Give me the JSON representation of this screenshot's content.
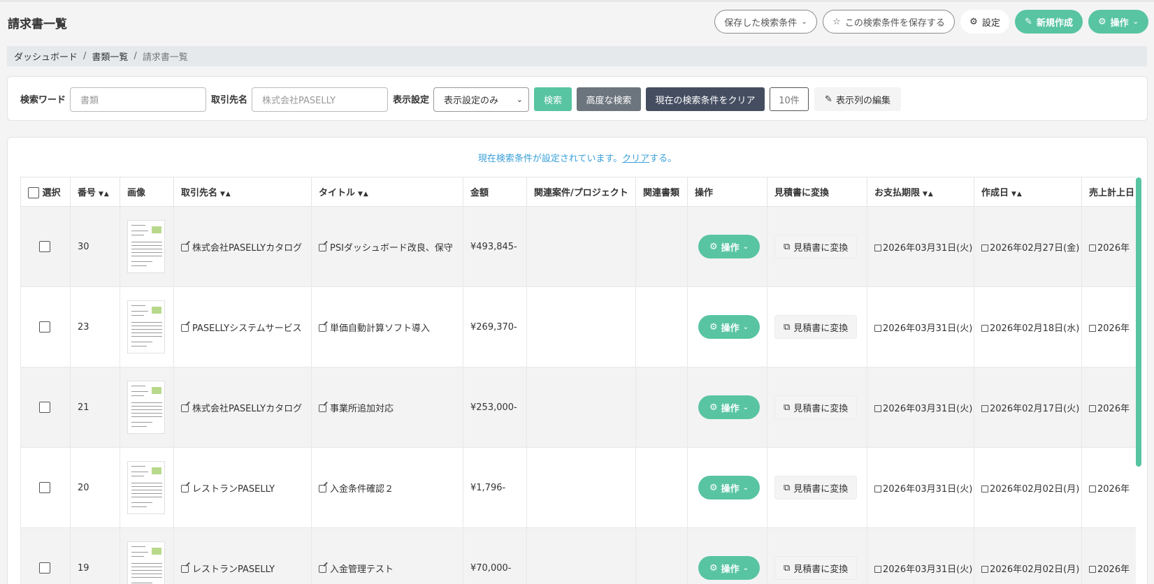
{
  "page": {
    "title": "請求書一覧"
  },
  "header_buttons": {
    "saved_search": "保存した検索条件",
    "save_search": "この検索条件を保存する",
    "settings": "設定",
    "new": "新規作成",
    "operations": "操作"
  },
  "breadcrumb": [
    "ダッシュボード",
    "書類一覧",
    "請求書一覧"
  ],
  "search": {
    "keyword_label": "検索ワード",
    "keyword_placeholder": "書類",
    "client_label": "取引先名",
    "client_placeholder": "株式会社PASELLY",
    "display_label": "表示設定",
    "display_value": "表示設定のみ",
    "search_button": "検索",
    "advanced_button": "高度な検索",
    "clear_button": "現在の検索条件をクリア",
    "per_page": "10件",
    "edit_columns": "表示列の編集"
  },
  "notice": {
    "prefix": "現在検索条件が設定されています。",
    "link": "クリア",
    "suffix": "する。"
  },
  "table": {
    "headers": [
      "選択",
      "番号",
      "画像",
      "取引先名",
      "タイトル",
      "金額",
      "関連案件/プロジェクト",
      "関連書類",
      "操作",
      "見積書に変換",
      "お支払期限",
      "作成日",
      "売上計上日"
    ],
    "op_label": "操作",
    "convert_label": "見積書に変換",
    "rows": [
      {
        "no": "30",
        "client": "株式会社PASELLYカタログ",
        "title": "PSIダッシュボード改良、保守",
        "amount": "¥493,845-",
        "due": "2026年03月31日(火)",
        "created": "2026年02月27日(金)",
        "sales": "2026年"
      },
      {
        "no": "23",
        "client": "PASELLYシステムサービス",
        "title": "単価自動計算ソフト導入",
        "amount": "¥269,370-",
        "due": "2026年03月31日(火)",
        "created": "2026年02月18日(水)",
        "sales": "2026年"
      },
      {
        "no": "21",
        "client": "株式会社PASELLYカタログ",
        "title": "事業所追加対応",
        "amount": "¥253,000-",
        "due": "2026年03月31日(火)",
        "created": "2026年02月17日(火)",
        "sales": "2026年"
      },
      {
        "no": "20",
        "client": "レストランPASELLY",
        "title": "入金条件確認２",
        "amount": "¥1,796-",
        "due": "2026年03月31日(火)",
        "created": "2026年02月02日(月)",
        "sales": "2026年"
      },
      {
        "no": "19",
        "client": "レストランPASELLY",
        "title": "入金管理テスト",
        "amount": "¥70,000-",
        "due": "2026年03月31日(火)",
        "created": "2026年02月02日(月)",
        "sales": "2026年"
      }
    ]
  },
  "colors": {
    "accent": "#58c4a2",
    "dark_button": "#454e61",
    "gray_button": "#6c757d",
    "link": "#3a9fd8"
  }
}
